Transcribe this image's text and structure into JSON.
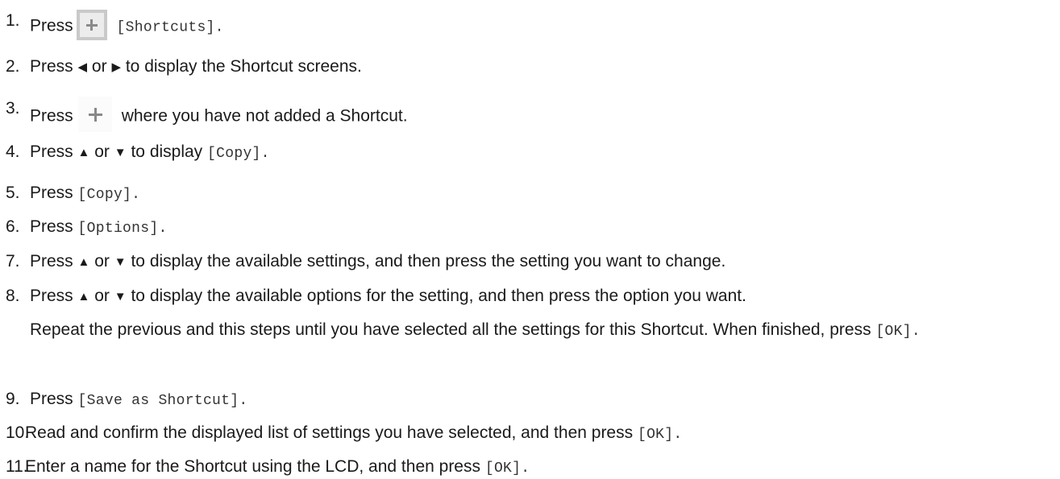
{
  "steps": [
    {
      "num": "1.",
      "pre": "Press",
      "mono": "[Shortcuts]."
    },
    {
      "num": "2.",
      "pre": "Press",
      "arrow_left": "◀",
      "mid": "or",
      "arrow_right": "▶",
      "post": "to display the Shortcut screens."
    },
    {
      "num": "3.",
      "pre": "Press",
      "post": "where you have not added a Shortcut."
    },
    {
      "num": "4.",
      "pre": "Press",
      "arrow_up": "▲",
      "mid": "or",
      "arrow_down": "▼",
      "post": "to display",
      "mono": "[Copy]."
    },
    {
      "num": "5.",
      "pre": "Press",
      "mono": "[Copy]."
    },
    {
      "num": "6.",
      "pre": "Press",
      "mono": "[Options]."
    },
    {
      "num": "7.",
      "pre": "Press",
      "arrow_up": "▲",
      "mid": "or",
      "arrow_down": "▼",
      "post": "to display the available settings, and then press the setting you want to change."
    },
    {
      "num": "8.",
      "pre": "Press",
      "arrow_up": "▲",
      "mid": "or",
      "arrow_down": "▼",
      "post": "to display the available options for the setting, and then press the option you want."
    },
    {
      "note_pre": "Repeat the previous and this steps until you have selected all the settings for this Shortcut. When finished, press",
      "note_mono": "[OK]."
    },
    {
      "num": "9.",
      "pre": "Press",
      "mono": "[Save as Shortcut]."
    },
    {
      "num": "10.",
      "pre": "Read and confirm the displayed list of settings you have selected, and then press",
      "mono": "[OK]."
    },
    {
      "num": "11.",
      "pre": "Enter a name for the Shortcut using the LCD, and then press",
      "mono": "[OK]."
    }
  ],
  "icons": {
    "shortcuts_icon": "plus-icon-boxed",
    "add_shortcut_icon": "plus-icon"
  },
  "colors": {
    "text": "#1a1a1a",
    "mono_text": "#333333",
    "icon_border": "#c9c9c9",
    "icon_fill": "#ececec",
    "icon_plus": "#8a8a8a"
  }
}
